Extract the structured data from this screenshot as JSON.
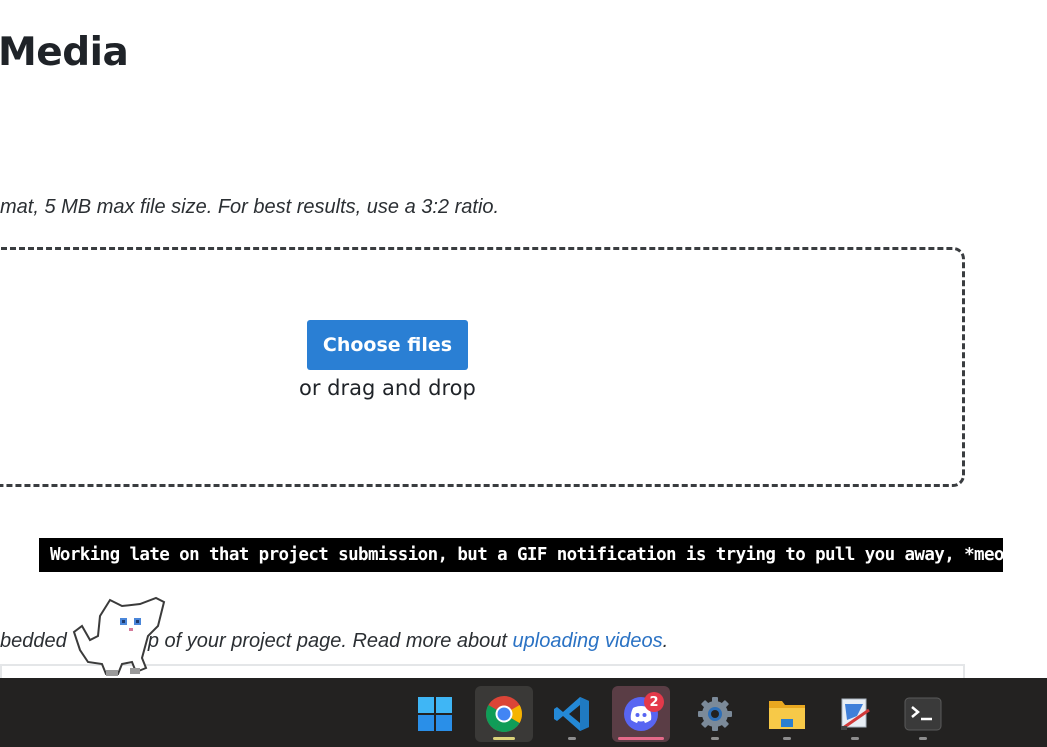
{
  "page": {
    "title": "Media",
    "image_hint": "mat, 5 MB max file size. For best results, use a 3:2 ratio.",
    "upload": {
      "button_label": "Choose files",
      "drag_text": "or drag and drop"
    },
    "video_hint": {
      "prefix": "bedded",
      "middle": "op of your project page. Read more about ",
      "link": "uploading videos",
      "suffix": "."
    }
  },
  "overlay": {
    "banner_text": "Working late on that project submission, but a GIF notification is trying to pull you away, *meow*."
  },
  "taskbar": {
    "apps": [
      {
        "name": "Start",
        "icon": "windows-logo-icon"
      },
      {
        "name": "Google Chrome",
        "icon": "chrome-icon"
      },
      {
        "name": "Visual Studio Code",
        "icon": "vscode-icon"
      },
      {
        "name": "Discord",
        "icon": "discord-icon",
        "badge": "2"
      },
      {
        "name": "Settings",
        "icon": "gear-icon"
      },
      {
        "name": "File Explorer",
        "icon": "folder-icon"
      },
      {
        "name": "Paint",
        "icon": "paint-icon"
      },
      {
        "name": "Terminal",
        "icon": "terminal-icon"
      }
    ],
    "colors": {
      "background": "#232221",
      "accent_blue": "#2a7fd4",
      "discord_badge": "#e4394a"
    }
  }
}
